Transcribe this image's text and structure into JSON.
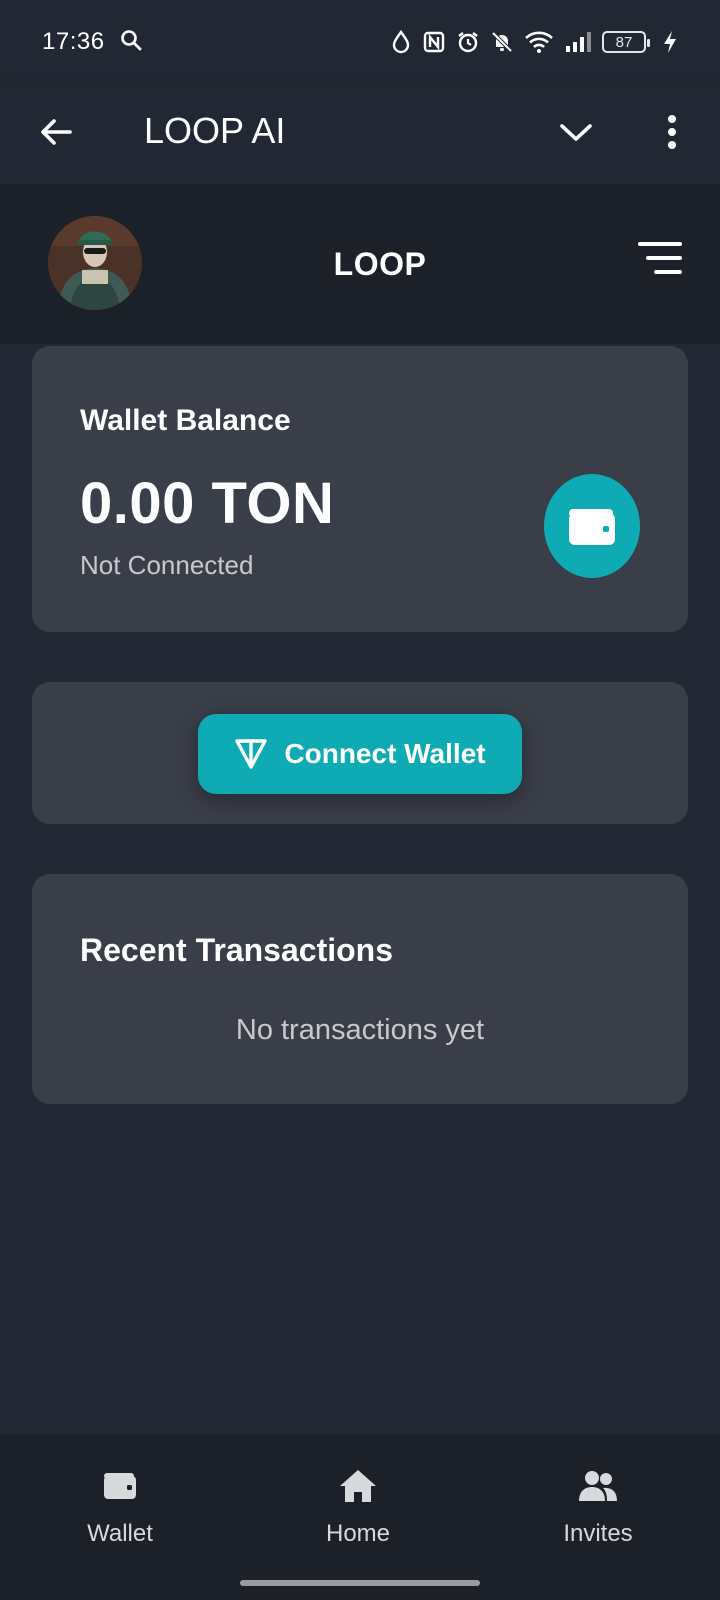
{
  "status_bar": {
    "time": "17:36",
    "battery": "87"
  },
  "app_bar": {
    "title": "LOOP AI"
  },
  "header": {
    "title": "LOOP"
  },
  "balance": {
    "label": "Wallet Balance",
    "value": "0.00 TON",
    "status": "Not Connected"
  },
  "connect": {
    "label": "Connect Wallet"
  },
  "transactions": {
    "title": "Recent Transactions",
    "empty": "No transactions yet"
  },
  "nav": {
    "items": [
      {
        "label": "Wallet",
        "icon": "wallet-icon"
      },
      {
        "label": "Home",
        "icon": "home-icon"
      },
      {
        "label": "Invites",
        "icon": "users-icon"
      }
    ]
  },
  "colors": {
    "accent": "#0eabb4",
    "background": "#222833",
    "card": "#3a3e48",
    "header": "#1c2028"
  }
}
